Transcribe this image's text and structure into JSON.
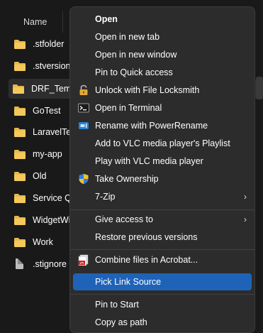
{
  "file_list": {
    "column_header": "Name",
    "items": [
      {
        "name": ".stfolder",
        "kind": "folder"
      },
      {
        "name": ".stversions",
        "kind": "folder"
      },
      {
        "name": "DRF_Templ",
        "kind": "folder",
        "selected": true
      },
      {
        "name": "GoTest",
        "kind": "folder"
      },
      {
        "name": "LaravelTest",
        "kind": "folder"
      },
      {
        "name": "my-app",
        "kind": "folder"
      },
      {
        "name": "Old",
        "kind": "folder"
      },
      {
        "name": "Service Qu",
        "kind": "folder"
      },
      {
        "name": "WidgetWin",
        "kind": "folder"
      },
      {
        "name": "Work",
        "kind": "folder"
      },
      {
        "name": ".stignore",
        "kind": "file"
      }
    ]
  },
  "context_menu": {
    "items": [
      {
        "label": "Open",
        "bold": true
      },
      {
        "label": "Open in new tab"
      },
      {
        "label": "Open in new window"
      },
      {
        "label": "Pin to Quick access"
      },
      {
        "label": "Unlock with File Locksmith",
        "icon": "lock-icon"
      },
      {
        "label": "Open in Terminal",
        "icon": "terminal-icon"
      },
      {
        "label": "Rename with PowerRename",
        "icon": "powerrename-icon"
      },
      {
        "label": "Add to VLC media player's Playlist"
      },
      {
        "label": "Play with VLC media player"
      },
      {
        "label": "Take Ownership",
        "icon": "shield-icon"
      },
      {
        "label": "7-Zip",
        "submenu": true
      },
      {
        "label": "Give access to",
        "submenu": true
      },
      {
        "label": "Restore previous versions"
      },
      {
        "label": "Combine files in Acrobat...",
        "icon": "acrobat-icon"
      },
      {
        "label": "Pick Link Source",
        "highlighted": true
      },
      {
        "label": "Pin to Start"
      },
      {
        "label": "Copy as path"
      }
    ]
  },
  "colors": {
    "background": "#191919",
    "menu_background": "#2c2c2c",
    "highlight": "#1f63b8",
    "folder": "#e8b84a"
  }
}
